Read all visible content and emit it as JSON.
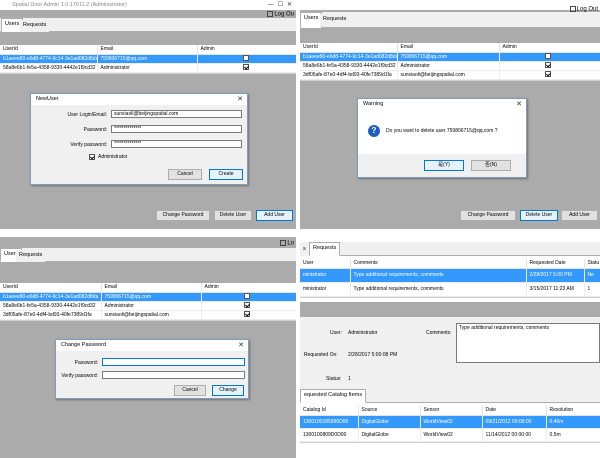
{
  "window": {
    "title": "Spatial Door Admin 1.0.17011.2 (Administrator)",
    "logout": "Log Out",
    "logout_short": "Log Ou"
  },
  "tabs": {
    "users": "Users",
    "requests": "Requests"
  },
  "users_grid": {
    "headers": [
      "UserId",
      "Email",
      "Admin"
    ],
    "rows": [
      {
        "id": "b1aeee80-e6d8-4774-9c14-3e1ad082d8da",
        "email": "759806715@qq.com",
        "admin": false,
        "selected": true
      },
      {
        "id": "58a8e6b1-fe5a-4358-9330-4442e1f9cd32",
        "email": "Administrator",
        "admin": true,
        "selected": false
      },
      {
        "id": "3df05afe-87e0-4df4-bd93-40fe7389d1fa",
        "email": "sunxiaoli@beijingspatial.com",
        "admin": true,
        "selected": false
      }
    ]
  },
  "buttons": {
    "change_password": "Change Password",
    "delete_user": "Delete User",
    "add_user": "Add User"
  },
  "new_user": {
    "title": "NewUser",
    "login_label": "User Login/Email:",
    "login_value": "sunxiaoli@beijingspatial.com",
    "password_label": "Password:",
    "password_value": "**************",
    "verify_label": "Verify password:",
    "verify_value": "**************",
    "admin_label": "Administrator",
    "cancel": "Cancel",
    "create": "Create"
  },
  "warning": {
    "title": "Warning",
    "message": "Do you want to delete user 759806715@qq.com ?",
    "yes": "是(Y)",
    "no": "否(N)"
  },
  "change_pw": {
    "title": "Change Password",
    "password_label": "Password:",
    "verify_label": "Verify password:",
    "cancel": "Cancel",
    "change": "Change"
  },
  "requests": {
    "headers": [
      "User",
      "Comments",
      "Requested Date",
      "Statu"
    ],
    "rows": [
      {
        "user": "ministrator",
        "comments": "Type additional requirements, comments",
        "date": "2/28/2017 5:00 PM",
        "status": "Ne",
        "selected": true
      },
      {
        "user": "ministrator",
        "comments": "Type additional requirements, comments",
        "date": "3/15/2017 11:23 AM",
        "status": "1",
        "selected": false
      }
    ],
    "detail": {
      "user_label": "User:",
      "user_value": "Administrator",
      "comments_label": "Comments:",
      "comments_value": "Type additional requirements, comments",
      "requested_on_label": "Requested On:",
      "requested_on_value": "2/28/2017 5:00:08 PM",
      "status_label": "Status:",
      "status_value": "1"
    },
    "catalog_tab": "equested Catalog Items",
    "catalog_headers": [
      "Catalog Id",
      "Source",
      "Sensor",
      "Date",
      "Resolution"
    ],
    "catalog_rows": [
      {
        "id": "1300100185990D00",
        "source": "DigitalGlobe",
        "sensor": "WorldView02",
        "date": "09/21/2012 00:00:00",
        "res": "0.46m",
        "selected": true
      },
      {
        "id": "1300100809D0D00",
        "source": "DigitalGlobe",
        "sensor": "WorldView02",
        "date": "11/14/2012 00:00:00",
        "res": "0.5m",
        "selected": false
      }
    ]
  }
}
